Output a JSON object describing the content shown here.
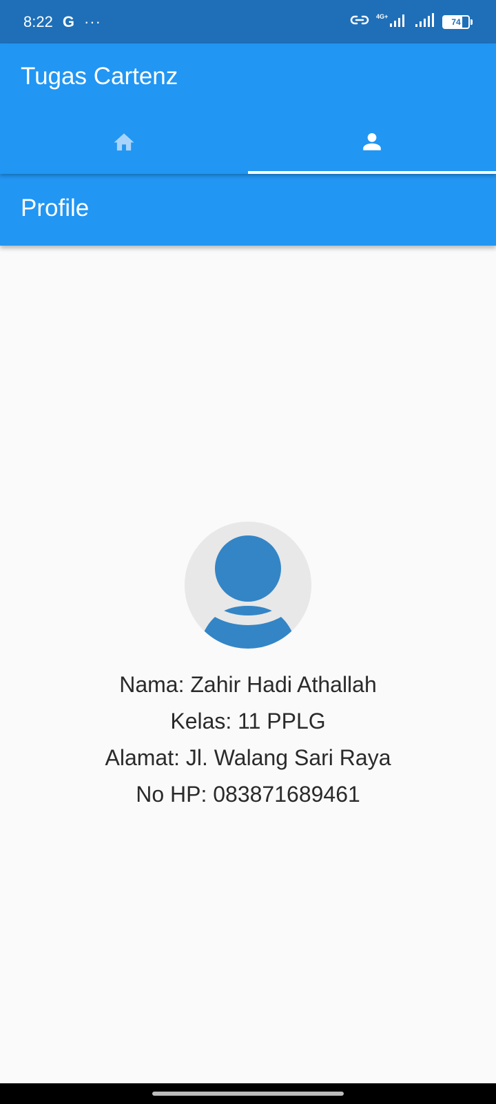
{
  "status_bar": {
    "time": "8:22",
    "g_label": "G",
    "dots": "···",
    "network": "4G+",
    "battery_level": "74"
  },
  "app": {
    "title": "Tugas Cartenz",
    "tabs": [
      {
        "icon": "home-icon",
        "selected": false
      },
      {
        "icon": "person-icon",
        "selected": true
      }
    ]
  },
  "page": {
    "title": "Profile"
  },
  "profile": {
    "name_line": "Nama: Zahir Hadi Athallah",
    "class_line": "Kelas: 11 PPLG",
    "address_line": "Alamat: Jl. Walang Sari Raya",
    "phone_line": "No HP: 083871689461"
  },
  "colors": {
    "primary": "#2196f3",
    "status_bar": "#1e6fb8",
    "avatar_fg": "#3385c6",
    "avatar_bg": "#e8e8e8"
  }
}
